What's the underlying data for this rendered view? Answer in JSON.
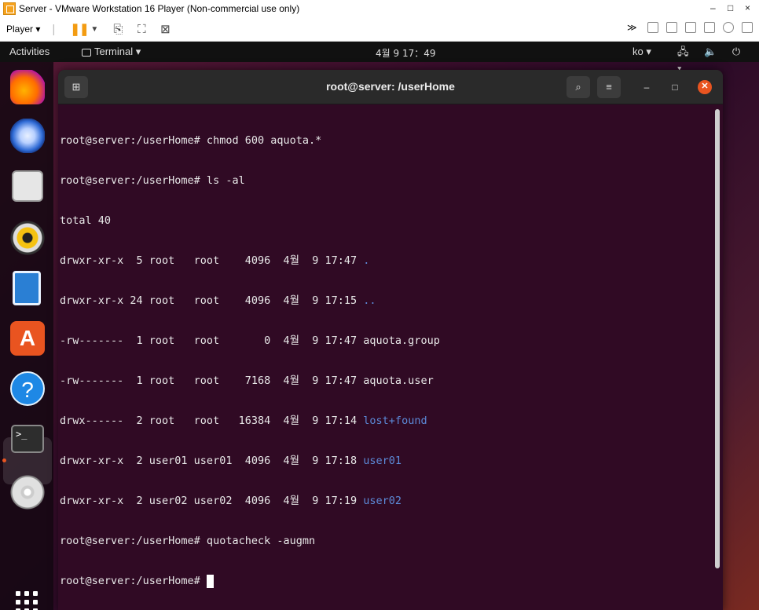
{
  "vmware": {
    "title": "Server - VMware Workstation 16 Player (Non-commercial use only)",
    "player_menu": "Player ▾",
    "window_controls": {
      "minimize": "–",
      "maximize": "□",
      "close": "×"
    }
  },
  "topbar": {
    "activities": "Activities",
    "app_menu": "Terminal ▾",
    "clock": "4월 9  17：49",
    "lang": "ko ▾",
    "system_icons": "🖧 🔈 ⏻ ▾"
  },
  "dock": {
    "items": [
      {
        "name": "Firefox",
        "icon": "firefox-icon"
      },
      {
        "name": "Thunderbird",
        "icon": "thunderbird-icon"
      },
      {
        "name": "Files",
        "icon": "files-icon"
      },
      {
        "name": "Rhythmbox",
        "icon": "rhythmbox-icon"
      },
      {
        "name": "LibreOffice Writer",
        "icon": "writer-icon"
      },
      {
        "name": "Ubuntu Software",
        "icon": "software-icon"
      },
      {
        "name": "Help",
        "icon": "help-icon"
      },
      {
        "name": "Terminal",
        "icon": "terminal-icon"
      },
      {
        "name": "DVD",
        "icon": "dvd-icon"
      }
    ],
    "show_apps": "show-apps-icon"
  },
  "terminal": {
    "title": "root@server: /userHome",
    "lines": [
      {
        "text": "root@server:/userHome# chmod 600 aquota.*"
      },
      {
        "text": "root@server:/userHome# ls -al"
      },
      {
        "text": "total 40"
      },
      {
        "text": "drwxr-xr-x  5 root   root    4096  4월  9 17:47 ",
        "link": "."
      },
      {
        "text": "drwxr-xr-x 24 root   root    4096  4월  9 17:15 ",
        "link": ".."
      },
      {
        "text": "-rw-------  1 root   root       0  4월  9 17:47 aquota.group"
      },
      {
        "text": "-rw-------  1 root   root    7168  4월  9 17:47 aquota.user"
      },
      {
        "text": "drwx------  2 root   root   16384  4월  9 17:14 ",
        "link": "lost+found"
      },
      {
        "text": "drwxr-xr-x  2 user01 user01  4096  4월  9 17:18 ",
        "link": "user01"
      },
      {
        "text": "drwxr-xr-x  2 user02 user02  4096  4월  9 17:19 ",
        "link": "user02"
      },
      {
        "text": "root@server:/userHome# quotacheck -augmn"
      },
      {
        "text": "root@server:/userHome# ",
        "cursor": true
      }
    ]
  }
}
